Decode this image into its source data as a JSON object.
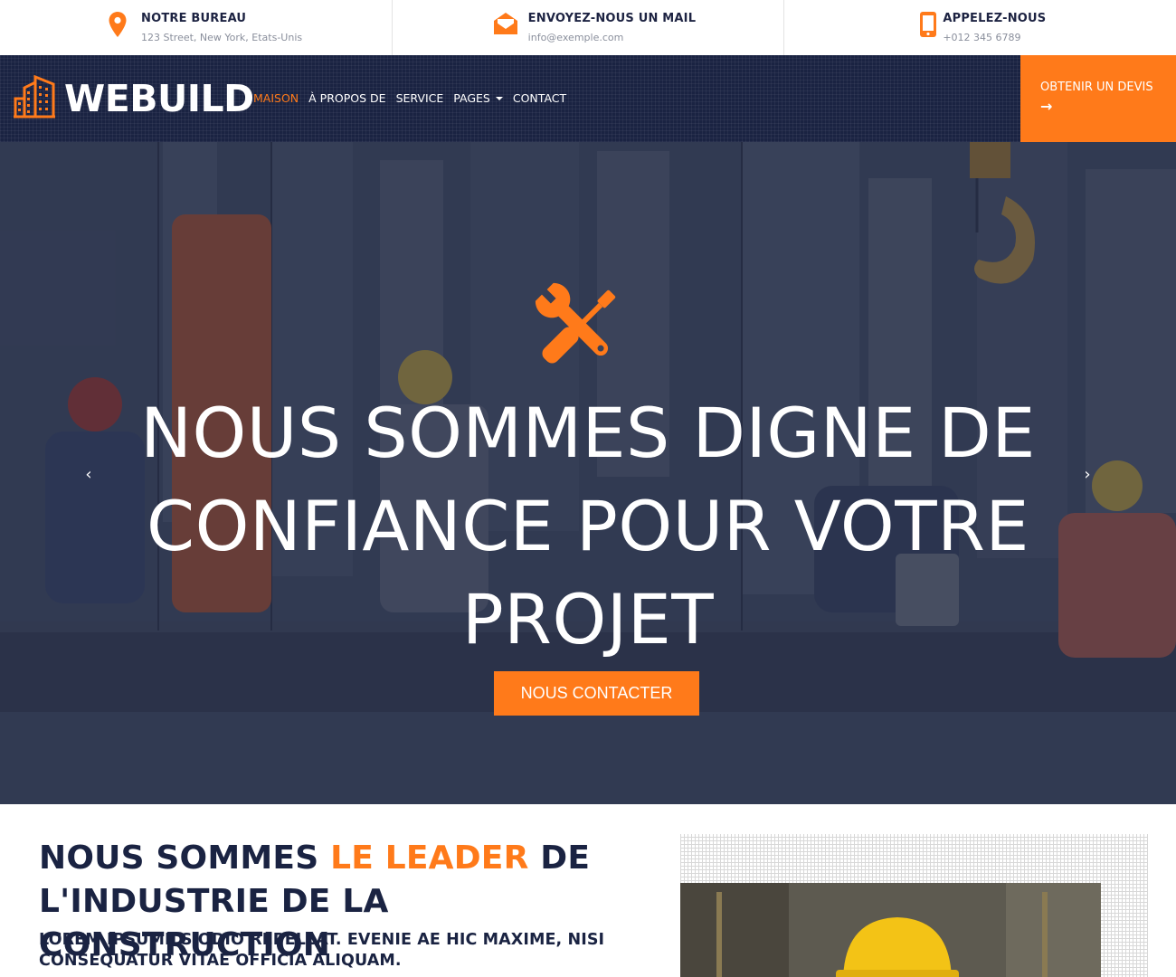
{
  "topbar": {
    "office": {
      "title": "NOTRE BUREAU",
      "detail": "123 Street, New York, Etats-Unis",
      "icon": "map-pin-icon"
    },
    "mail": {
      "title": "ENVOYEZ-NOUS UN MAIL",
      "detail": "info@exemple.com",
      "icon": "envelope-open-icon"
    },
    "phone": {
      "title": "APPELEZ-NOUS",
      "detail": "+012 345 6789",
      "icon": "mobile-phone-icon"
    }
  },
  "brand": {
    "name": "WEBUILD",
    "logo_icon": "building-icon"
  },
  "nav": {
    "items": [
      {
        "label": "MAISON",
        "active": true
      },
      {
        "label": "À PROPOS DE",
        "active": false
      },
      {
        "label": "SERVICE",
        "active": false
      },
      {
        "label": "PAGES",
        "active": false,
        "dropdown": true
      },
      {
        "label": "CONTACT",
        "active": false
      }
    ],
    "quote_label": "OBTENIR UN DEVIS",
    "quote_arrow": "→"
  },
  "hero": {
    "icon": "tools-icon",
    "heading": "NOUS SOMMES DIGNE DE CONFIANCE POUR VOTRE PROJET",
    "cta_label": "NOUS CONTACTER",
    "prev_label": "‹",
    "next_label": "›"
  },
  "about": {
    "heading_before": "NOUS SOMMES ",
    "heading_highlight": "LE LEADER",
    "heading_after": " DE L'INDUSTRIE DE LA CONSTRUCTION",
    "lead": "LOREM IPSUMILS ODIO REPELLAT. EVENIE AE HIC MAXIME, NISI CONSEQUATUR VITAE OFFICIA ALIQUAM."
  },
  "colors": {
    "accent": "#ff7a1a",
    "navy": "#1a2342",
    "white": "#ffffff"
  }
}
